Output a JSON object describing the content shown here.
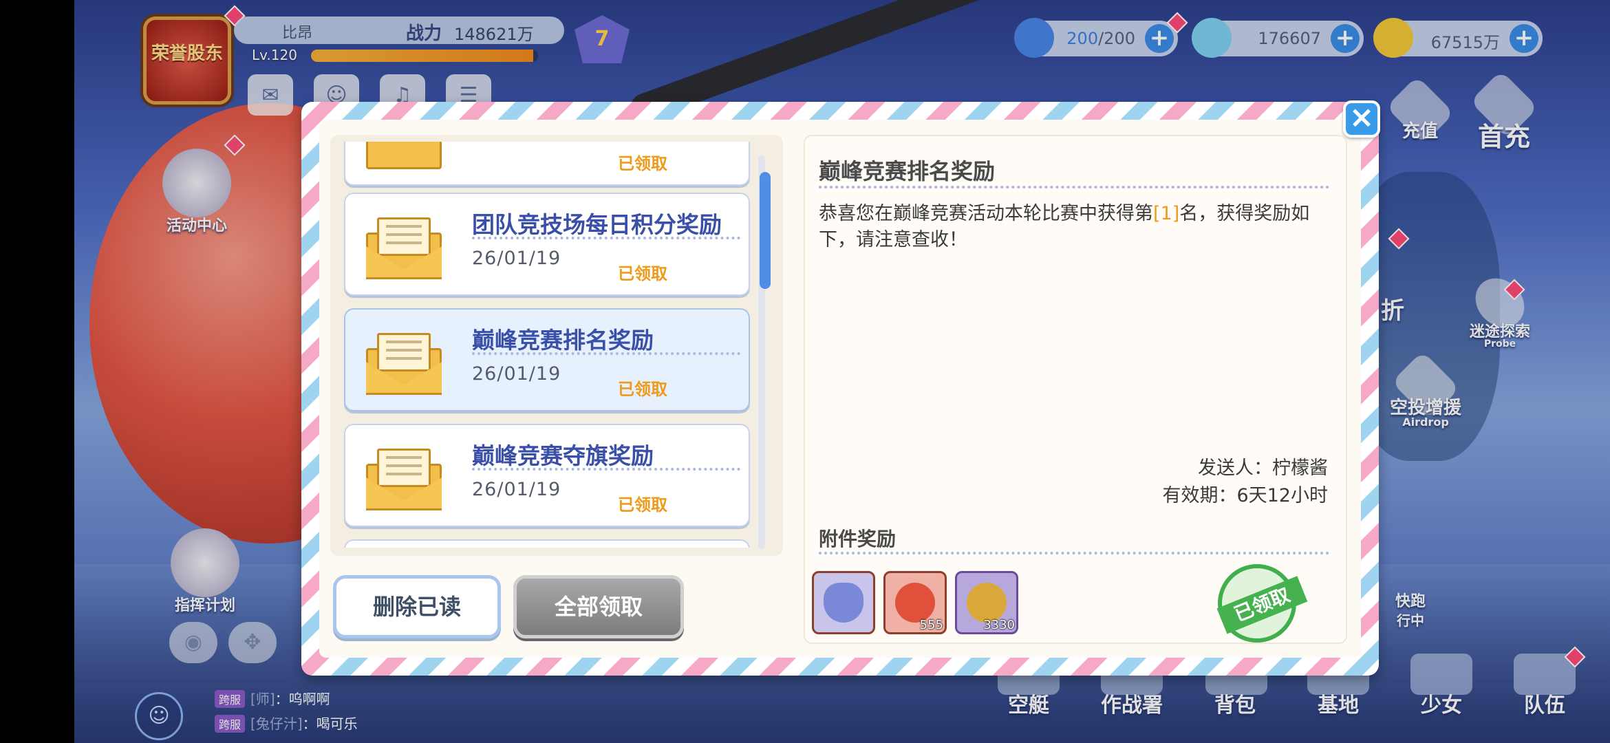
{
  "player": {
    "avatar_text": "荣誉股东",
    "name": "比昂",
    "power_label": "战力",
    "power_value": "148621万",
    "level": "Lv.120",
    "xp_fraction": 0.98,
    "rank_badge": "7"
  },
  "resources": [
    {
      "name": "stamina",
      "value_current": "200",
      "value_rest": "/200",
      "icon": "energy-crystal-icon",
      "color": "#4a86e8"
    },
    {
      "name": "diamond",
      "value": "176607",
      "icon": "diamond-icon",
      "color": "#7fd1f0"
    },
    {
      "name": "gold",
      "value": "67515万",
      "icon": "gold-coin-icon",
      "color": "#f2c83a"
    }
  ],
  "right_nav": {
    "recharge": "充值",
    "first_recharge": "首充",
    "probe": "迷途探索",
    "probe_en": "Probe",
    "airdrop": "空投增援",
    "airdrop_en": "Airdrop",
    "partial_1": "折",
    "partial_2": "快跑",
    "partial_3": "行中"
  },
  "left_side": {
    "activity_center": "活动中心",
    "command_plan": "指挥计划"
  },
  "bottom_nav": [
    "空艇",
    "作战署",
    "背包",
    "基地",
    "少女",
    "队伍"
  ],
  "chat": [
    {
      "tag": "跨服",
      "channel": "[师]",
      "text": "：呜啊啊"
    },
    {
      "tag": "跨服",
      "channel": "[兔仔汁]",
      "text": "：喝可乐"
    }
  ],
  "mail": {
    "items": [
      {
        "title": "团队竞技场每日积分奖励",
        "date": "26/01/19",
        "status": "已领取",
        "selected": false
      },
      {
        "title": "巅峰竞赛排名奖励",
        "date": "26/01/19",
        "status": "已领取",
        "selected": true
      },
      {
        "title": "巅峰竞赛夺旗奖励",
        "date": "26/01/19",
        "status": "已领取",
        "selected": false
      }
    ],
    "partial_top_status": "已领取",
    "delete_read_label": "删除已读",
    "claim_all_label": "全部领取",
    "close_label": "×",
    "detail": {
      "title": "巅峰竞赛排名奖励",
      "body_prefix": "恭喜您在巅峰竞赛活动本轮比赛中获得第",
      "rank": "[1]",
      "body_suffix": "名，获得奖励如下，请注意查收！",
      "sender": "发送人：柠檬酱",
      "expiry": "有效期：6天12小时",
      "attachments_label": "附件奖励",
      "attachments": [
        {
          "icon": "heart-frame-icon",
          "qty": "",
          "color": "#7a88d8"
        },
        {
          "icon": "red-medal-icon",
          "qty": "555",
          "color": "#e0503a"
        },
        {
          "icon": "gold-medal-icon",
          "qty": "3330",
          "color": "#d9a83a"
        }
      ],
      "claimed_stamp": "已领取"
    }
  }
}
